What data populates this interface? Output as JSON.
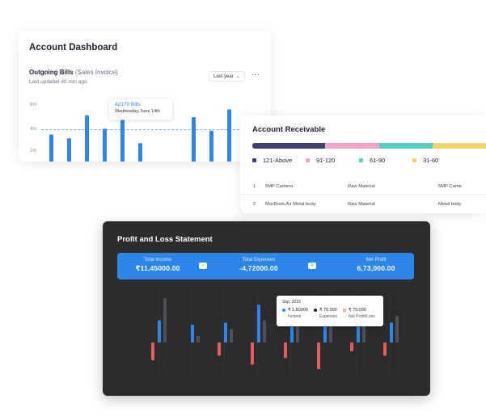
{
  "dashboard": {
    "title": "Account Dashboard",
    "chart_title": "Outgoing Bills",
    "chart_title_muted": "(Sales Invoice)",
    "updated": "Last updated 40 min ago",
    "period": "Last year",
    "more": "···",
    "y_ticks": [
      "6m",
      "4m",
      "2m"
    ],
    "tooltip": {
      "value": "42170 Bills",
      "date": "Wednesday, June 14th"
    },
    "colors": {
      "bar": "#2e86e6",
      "reference": "#7db3ef"
    }
  },
  "receivable": {
    "title": "Account Receivable",
    "segments": [
      {
        "label": "121-Above",
        "color": "#3d3f6e",
        "share": 0.31
      },
      {
        "label": "91-120",
        "color": "#f3a2c9",
        "share": 0.23
      },
      {
        "label": "61-90",
        "color": "#56d1c1",
        "share": 0.23
      },
      {
        "label": "31-60",
        "color": "#f4cf6a",
        "share": 0.23
      }
    ],
    "rows": [
      {
        "num": "1",
        "item": "5MP Camera",
        "category": "Raw Material",
        "extra": "5MP Came"
      },
      {
        "num": "2",
        "item": "MacBook Air Metal body",
        "category": "Raw Material",
        "extra": "Metal body"
      }
    ]
  },
  "profit_loss": {
    "title": "Profit and Loss Statement",
    "total_income_label": "Total Income",
    "total_income": "₹11,45000.00",
    "total_expenses_label": "Total Expenses",
    "total_expenses": "-4,72000.00",
    "net_profit_label": "Net Profit",
    "net_profit": "6,73,000.00",
    "op_minus": "−",
    "op_equals": "=",
    "tooltip": {
      "date": "Sep, 2018",
      "items": [
        {
          "value": "₹ 1,50000",
          "label": "Income",
          "color": "#2e86e6"
        },
        {
          "value": "₹ 75,000",
          "label": "Expenses",
          "color": "#222222"
        },
        {
          "value": "₹ 75,000",
          "label": "Net Profit/Loss",
          "color": "#f08080"
        }
      ]
    },
    "colors": {
      "income": "#2e86e6",
      "expenses": "#505055",
      "net": "#e85c5c"
    }
  },
  "chart_data": [
    {
      "type": "bar",
      "title": "Outgoing Bills",
      "subtitle": "(Sales Invoice)",
      "ylim": [
        0,
        6
      ],
      "y_ticks": [
        "2m",
        "4m",
        "6m"
      ],
      "series": [
        {
          "values": [
            2.8,
            2.4,
            4.8,
            3.4,
            4.3,
            1.9,
            0,
            0,
            4.6,
            3.2,
            5.4,
            3.2
          ]
        }
      ],
      "reference_line": 4
    },
    {
      "type": "bar",
      "title": "Profit and Loss Statement",
      "series": [
        {
          "values": [
            0.5,
            0.4,
            0.45,
            0.85,
            0.8,
            0.6,
            0.5,
            0.45
          ]
        },
        {
          "values": [
            1.0,
            0.15,
            0.3,
            0.5,
            0.95,
            0.7,
            0.45,
            0.6
          ]
        },
        {
          "values": [
            -0.4,
            0,
            -0.3,
            -0.5,
            -0.35,
            -0.6,
            -0.2,
            -0.3
          ]
        }
      ]
    }
  ]
}
